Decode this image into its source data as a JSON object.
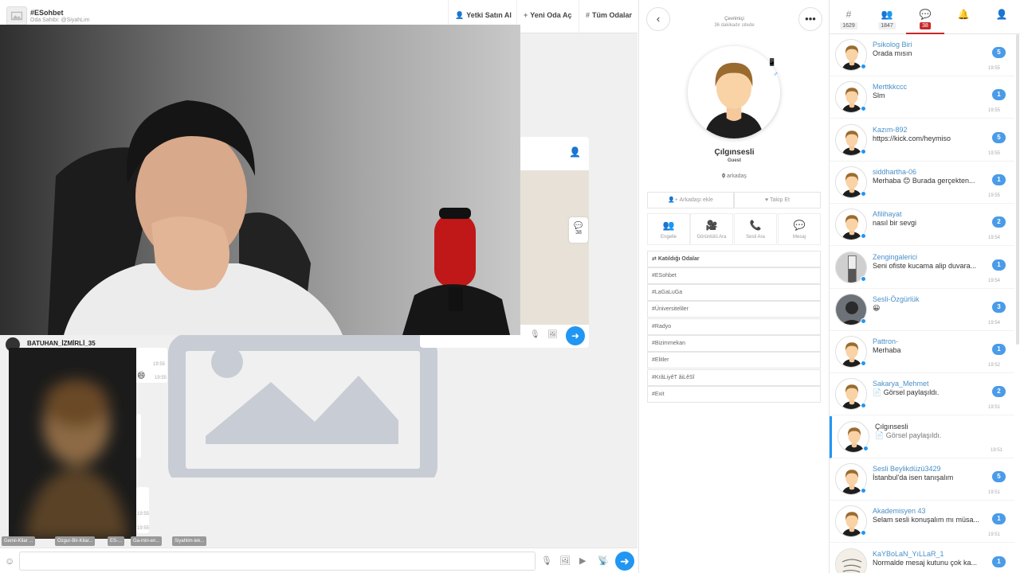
{
  "room": {
    "title": "#ESohbet",
    "owner": "Oda Sahibi: @SiyahLim",
    "header_buttons": [
      {
        "icon": "user-cog-icon",
        "label": "Yetki Satın Al"
      },
      {
        "icon": "plus-icon",
        "label": "Yeni Oda Aç"
      },
      {
        "icon": "hash-icon",
        "label": "Tüm Odalar"
      }
    ],
    "cam_user": "BATUHAN_İZMİRLİ_35",
    "chat_badge_count": "38",
    "bubble_times": [
      "19:55",
      "19:55",
      "19:55",
      "19:55"
    ],
    "chips": [
      "Gemii-Kilar ...",
      "Ozgur-Bir-Kilar...",
      "ES-...",
      "Ga-min-en...",
      "Siyahlim-lek..."
    ],
    "input_placeholder": ""
  },
  "profile": {
    "status": "Çevrimiçi",
    "since": "36 dakikadır sitede",
    "name": "Çılgınsesli",
    "rank": "Guest",
    "friends_count": "0",
    "friends_label": "arkadaş",
    "add_friend": "Arkadaşı ekle",
    "follow": "Takip Et",
    "actions": [
      {
        "icon": "block-icon",
        "label": "Engelle"
      },
      {
        "icon": "video-icon",
        "label": "Görüntülü Ara"
      },
      {
        "icon": "phone-icon",
        "label": "Sesli Ara"
      },
      {
        "icon": "message-icon",
        "label": "Mesaj"
      }
    ],
    "rooms_header": "Katıldığı Odalar",
    "rooms": [
      "#ESohbet",
      "#LaGaLuGa",
      "#Üniversiteliler",
      "#Radyo",
      "#Bizimmekan",
      "#Elitler",
      "#KrâLiyêT âiLêSî",
      "#Exit"
    ]
  },
  "pm": {
    "tabs": [
      {
        "icon": "hash-icon",
        "count": "1629",
        "active": false
      },
      {
        "icon": "users-icon",
        "count": "1847",
        "active": false
      },
      {
        "icon": "chat-icon",
        "count": "38",
        "active": true
      },
      {
        "icon": "bell-icon",
        "count": "",
        "active": false
      },
      {
        "icon": "user-icon",
        "count": "",
        "active": false
      }
    ],
    "items": [
      {
        "name": "Psikolog Biri",
        "message": "Orada mısın",
        "badge": "5",
        "time": "19:55",
        "avatar": "default"
      },
      {
        "name": "Merttkkccc",
        "message": "Slm",
        "badge": "1",
        "time": "19:55",
        "avatar": "default"
      },
      {
        "name": "Kazım-892",
        "message": "https://kick.com/heymiso",
        "badge": "5",
        "time": "19:55",
        "avatar": "default"
      },
      {
        "name": "siddhartha-06",
        "message": "Merhaba 😊 Burada gerçekten...",
        "badge": "1",
        "time": "19:55",
        "avatar": "default"
      },
      {
        "name": "Afilihayat",
        "message": "nasıl bir sevgi",
        "badge": "2",
        "time": "19:54",
        "avatar": "default"
      },
      {
        "name": "Zengingalerici",
        "message": "Seni ofiste kucama alip duvara...",
        "badge": "1",
        "time": "19:54",
        "avatar": "photo"
      },
      {
        "name": "Sesli-Özgürlük",
        "message": "😀",
        "badge": "3",
        "time": "19:54",
        "avatar": "photo-dark"
      },
      {
        "name": "Pattron-",
        "message": "Merhaba",
        "badge": "1",
        "time": "19:52",
        "avatar": "default"
      },
      {
        "name": "Sakarya_Mehmet",
        "message": "📄 Görsel paylaşıldı.",
        "badge": "2",
        "time": "19:51",
        "avatar": "default"
      },
      {
        "name": "Çılgınsesli",
        "message": "📄 Görsel paylaşıldı.",
        "badge": "",
        "time": "19:51",
        "avatar": "default",
        "selected": true
      },
      {
        "name": "Sesli Beylikdüzü3429",
        "message": "İstanbul'da isen tanışalım",
        "badge": "5",
        "time": "19:51",
        "avatar": "default"
      },
      {
        "name": "Akademisyen 43",
        "message": "Selam sesli konuşalım mı müsa...",
        "badge": "1",
        "time": "19:51",
        "avatar": "default"
      },
      {
        "name": "KaYBoLaN_YıLLaR_1",
        "message": "Normalde mesaj kutunu çok ka...",
        "badge": "1",
        "time": "",
        "avatar": "text"
      }
    ]
  },
  "colors": {
    "accent": "#2196f3",
    "badge": "#4a9be8",
    "active_tab": "#c62828"
  }
}
